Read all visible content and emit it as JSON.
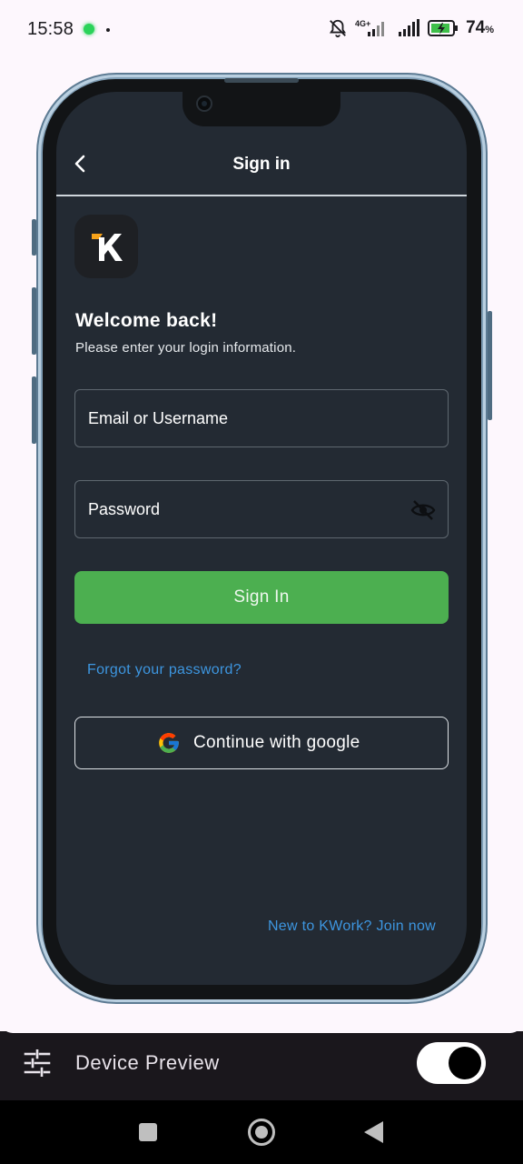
{
  "status_bar": {
    "time": "15:58",
    "network_label": "4G+",
    "battery_percent": "74",
    "battery_unit": "%",
    "icons": [
      "notification-dot-icon",
      "silent-bell-icon",
      "signal-4g-icon",
      "signal-icon",
      "battery-charging-icon"
    ]
  },
  "app": {
    "title": "Sign in",
    "logo_letter": "K",
    "welcome": "Welcome back!",
    "subtitle": "Please enter your login information.",
    "email_placeholder": "Email or Username",
    "password_placeholder": "Password",
    "signin_label": "Sign In",
    "forgot_label": "Forgot your password?",
    "google_label": "Continue with google",
    "join_label": "New to KWork? Join now",
    "colors": {
      "background": "#232a33",
      "primary_button": "#4caf50",
      "link": "#3d96e0",
      "logo_accent": "#f6a21a"
    }
  },
  "device_preview": {
    "label": "Device Preview",
    "toggle_on": true
  },
  "nav": {
    "icons": [
      "recents-square-icon",
      "home-circle-icon",
      "back-triangle-icon"
    ]
  }
}
